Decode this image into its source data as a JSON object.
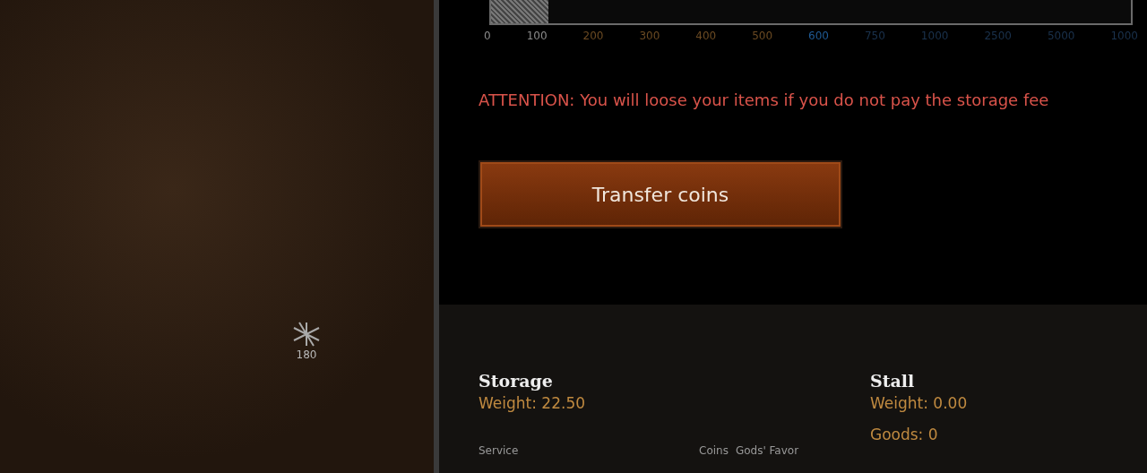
{
  "map_marker": {
    "label": "180"
  },
  "slider": {
    "level": 0.09,
    "ticks": [
      {
        "label": "0",
        "color": "#8a8a8a"
      },
      {
        "label": "100",
        "color": "#8a8a8a"
      },
      {
        "label": "200",
        "color": "#6b4a22"
      },
      {
        "label": "300",
        "color": "#6b4a22"
      },
      {
        "label": "400",
        "color": "#6b4a22"
      },
      {
        "label": "500",
        "color": "#6b4a22"
      },
      {
        "label": "600",
        "color": "#1f5a94"
      },
      {
        "label": "750",
        "color": "#1a324d"
      },
      {
        "label": "1000",
        "color": "#1a324d"
      },
      {
        "label": "2500",
        "color": "#1a324d"
      },
      {
        "label": "5000",
        "color": "#1a324d"
      },
      {
        "label": "1000",
        "color": "#1a324d"
      }
    ]
  },
  "warning": "ATTENTION: You will loose your items if you do not pay the storage fee",
  "transfer_button": "Transfer coins",
  "storage": {
    "title": "Storage",
    "weight": "Weight: 22.50"
  },
  "stall": {
    "title": "Stall",
    "weight": "Weight: 0.00",
    "goods": "Goods: 0"
  },
  "table_header": {
    "service": "Service",
    "coins": "Coins",
    "favor": "Gods' Favor"
  }
}
